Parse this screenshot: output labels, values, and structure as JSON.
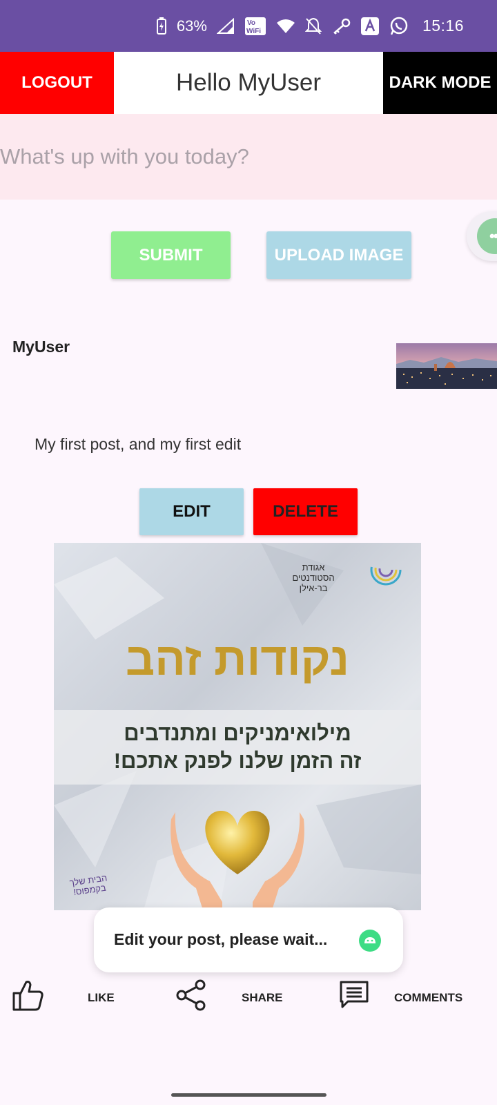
{
  "status_bar": {
    "battery": "63%",
    "time": "15:16",
    "icons": [
      "battery-icon",
      "signal-icon",
      "vowifi-icon",
      "wifi-icon",
      "mute-icon",
      "key-icon",
      "app-icon",
      "whatsapp-icon"
    ],
    "bg_color": "#6a4fa3",
    "vowifi_label": "Vo WiFi"
  },
  "header": {
    "logout_label": "LOGOUT",
    "greeting": "Hello MyUser",
    "dark_mode_label": "DARK MODE",
    "logout_color": "#ff0000",
    "dark_mode_color": "#000000"
  },
  "composer": {
    "placeholder": "What's up with you today?",
    "value": "",
    "submit_label": "SUBMIT",
    "upload_label": "UPLOAD IMAGE",
    "submit_color": "#90ee90",
    "upload_color": "#add8e6"
  },
  "floating_bubble": {
    "icon": "more-dots-icon"
  },
  "post": {
    "author": "MyUser",
    "text": "My first post, and my first edit",
    "edit_label": "EDIT",
    "delete_label": "DELETE",
    "thumbnail": "city-skyline-thumbnail",
    "image": {
      "org_lines": [
        "אגודת",
        "הסטודנטים",
        "בר-אילן"
      ],
      "title": "נקודות זהב",
      "line1": "מילואימניקים ומתנדבים",
      "line2": "זה הזמן שלנו לפנק אתכם!",
      "corner": "הבית שלך בקמפוס!",
      "title_color": "#c49a2c"
    }
  },
  "toast": {
    "text": "Edit your post, please wait...",
    "icon": "android-icon"
  },
  "actions": {
    "like_label": "LIKE",
    "share_label": "SHARE",
    "comments_label": "COMMENTS"
  }
}
